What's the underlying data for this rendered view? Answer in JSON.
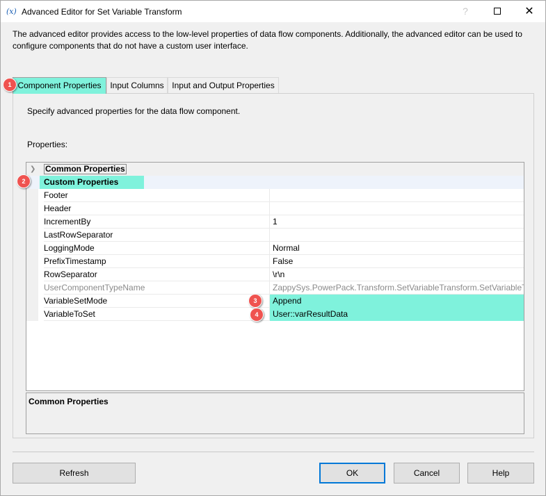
{
  "window": {
    "title": "Advanced Editor for Set Variable Transform",
    "icon_glyph": "(x)"
  },
  "description": "The advanced editor provides access to the low-level properties of data flow components. Additionally, the advanced editor can be used to configure components that do not have a custom user interface.",
  "tabs": [
    {
      "label": "Component Properties",
      "active": true
    },
    {
      "label": "Input Columns",
      "active": false
    },
    {
      "label": "Input and Output Properties",
      "active": false
    }
  ],
  "panel": {
    "description": "Specify advanced properties for the data flow component.",
    "properties_label": "Properties:"
  },
  "grid": {
    "common_category": "Common Properties",
    "custom_category": "Custom Properties",
    "rows": [
      {
        "name": "Footer",
        "value": ""
      },
      {
        "name": "Header",
        "value": ""
      },
      {
        "name": "IncrementBy",
        "value": "1"
      },
      {
        "name": "LastRowSeparator",
        "value": ""
      },
      {
        "name": "LoggingMode",
        "value": "Normal"
      },
      {
        "name": "PrefixTimestamp",
        "value": "False"
      },
      {
        "name": "RowSeparator",
        "value": "\\r\\n"
      },
      {
        "name": "UserComponentTypeName",
        "value": "ZappySys.PowerPack.Transform.SetVariableTransform.SetVariableTransform"
      },
      {
        "name": "VariableSetMode",
        "value": "Append"
      },
      {
        "name": "VariableToSet",
        "value": "User::varResultData"
      }
    ]
  },
  "description_pane": {
    "title": "Common Properties"
  },
  "badges": [
    "1",
    "2",
    "3",
    "4"
  ],
  "buttons": {
    "refresh": "Refresh",
    "ok": "OK",
    "cancel": "Cancel",
    "help": "Help"
  },
  "colors": {
    "highlight": "#7ff2dc",
    "badge": "#ef5350",
    "ok_border": "#0078d7"
  },
  "icons": {
    "help": "question-mark-icon",
    "maximize": "maximize-icon",
    "close": "close-icon",
    "expander": "chevron-right-icon"
  }
}
